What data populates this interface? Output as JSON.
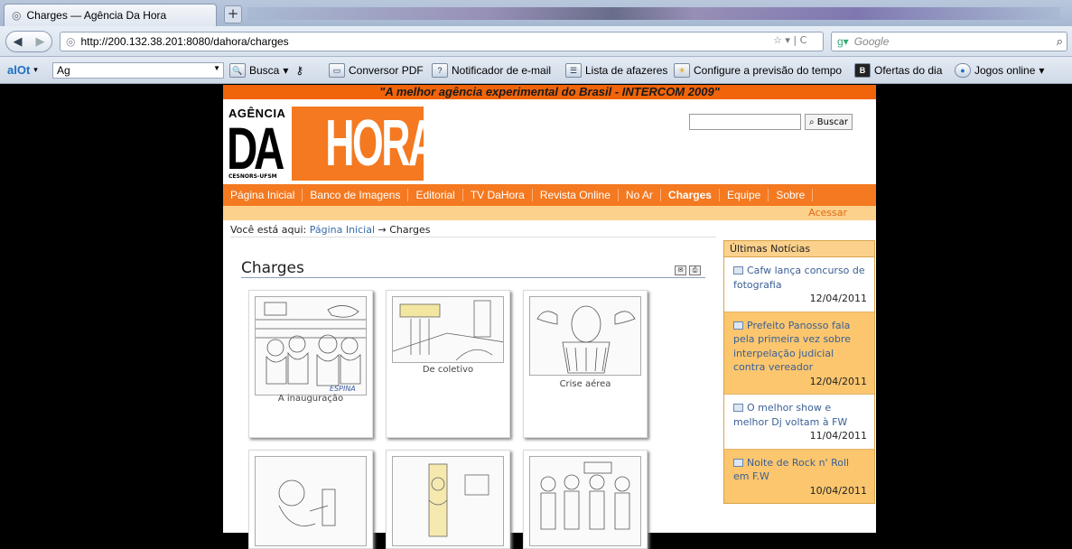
{
  "browser": {
    "tab_title": "Charges — Agência Da Hora",
    "new_tab": "+",
    "url": "http://200.132.38.201:8080/dahora/charges",
    "search_placeholder": "Google"
  },
  "addon_toolbar": {
    "logo": "alOt",
    "field_value": "Ag",
    "items": [
      "Busca",
      "Conversor PDF",
      "Notificador de e-mail",
      "Lista de afazeres",
      "Configure a previsão do tempo",
      "Ofertas do dia",
      "Jogos online"
    ]
  },
  "site": {
    "slogan": "\"A melhor agência experimental do Brasil - INTERCOM 2009\"",
    "logo": {
      "top": "AGÊNCIA",
      "left": "DA",
      "right": "HORA",
      "bottom": "CESNORS-UFSM"
    },
    "search_button": "Buscar",
    "menu": [
      "Página Inicial",
      "Banco de Imagens",
      "Editorial",
      "TV DaHora",
      "Revista Online",
      "No Ar",
      "Charges",
      "Equipe",
      "Sobre"
    ],
    "login": "Acessar",
    "breadcrumb": {
      "prefix": "Você está aqui:",
      "home": "Página Inicial",
      "arrow": "→",
      "current": "Charges"
    },
    "page_title": "Charges",
    "cartoons": [
      {
        "caption": "A inauguração",
        "signature": "ESPINA"
      },
      {
        "caption": "De coletivo"
      },
      {
        "caption": "Crise aérea"
      },
      {
        "caption": ""
      },
      {
        "caption": ""
      },
      {
        "caption": ""
      }
    ]
  },
  "sidebar": {
    "title": "Últimas Notícias",
    "news": [
      {
        "headline": "Cafw lança concurso de fotografia",
        "date": "12/04/2011"
      },
      {
        "headline": "Prefeito Panosso fala pela primeira vez sobre interpelação judicial contra vereador",
        "date": "12/04/2011"
      },
      {
        "headline": "O melhor show e melhor Dj voltam à FW",
        "date": "11/04/2011"
      },
      {
        "headline": "Noite de Rock n' Roll em F.W",
        "date": "10/04/2011"
      }
    ]
  },
  "colors": {
    "orange": "#f47920",
    "light_orange": "#fcd18c",
    "link": "#3a5f96"
  }
}
